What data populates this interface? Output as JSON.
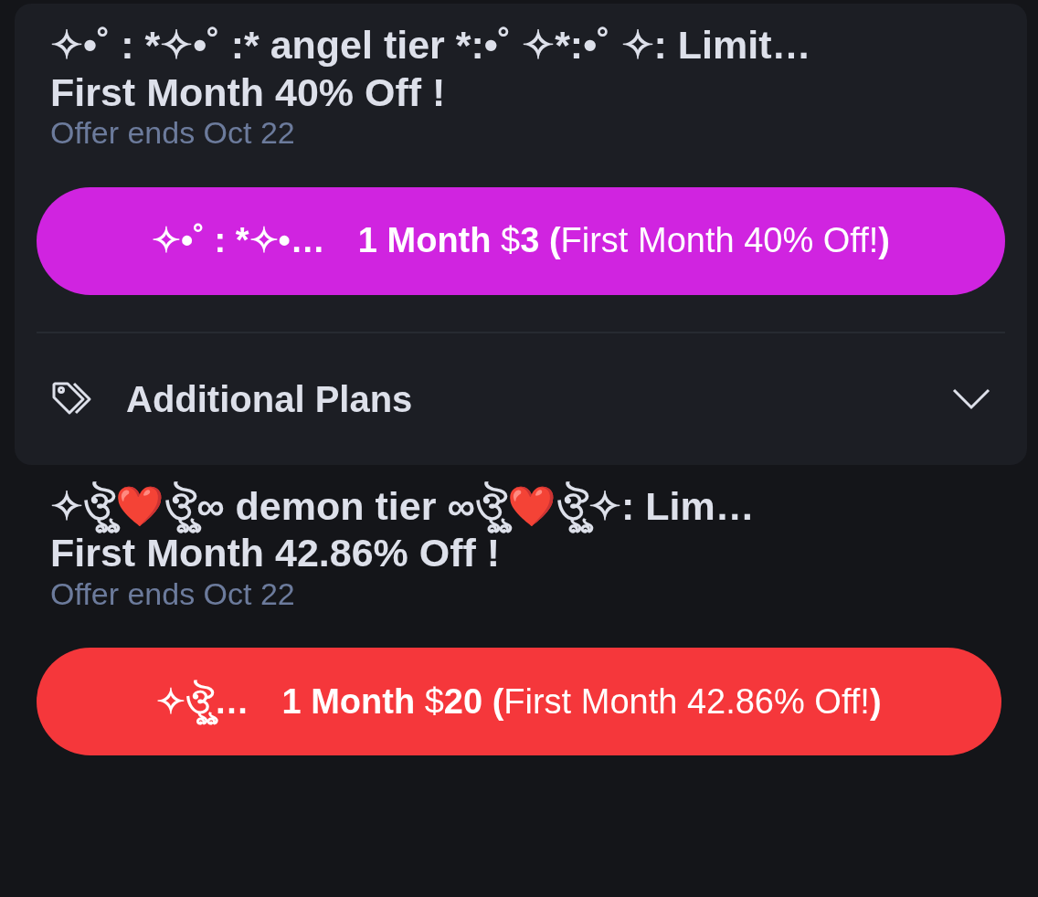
{
  "tiers": [
    {
      "title": "✧•˚ : *✧•˚ :* angel tier *:•˚ ✧*:•˚ ✧: Limit…",
      "promo": "First Month 40% Off !",
      "offer": "Offer ends Oct 22",
      "color": "#d024e0",
      "button": {
        "prefix": "✧•˚ : *✧•…",
        "label": "**1 Month** $**3** **(**First Month 40% Off!**)**"
      },
      "additional": {
        "label": "Additional Plans",
        "expanded": false
      }
    },
    {
      "title": "✧ঔৣ❤️ঔৣ∞ demon tier ∞ঔৣ❤️ঔৣ✧: Lim…",
      "promo": "First Month 42.86% Off !",
      "offer": "Offer ends Oct 22",
      "color": "#f5373b",
      "button": {
        "prefix": "✧ঔৣ…",
        "label": "**1 Month** $**20** **(**First Month 42.86% Off!**)**"
      }
    }
  ]
}
